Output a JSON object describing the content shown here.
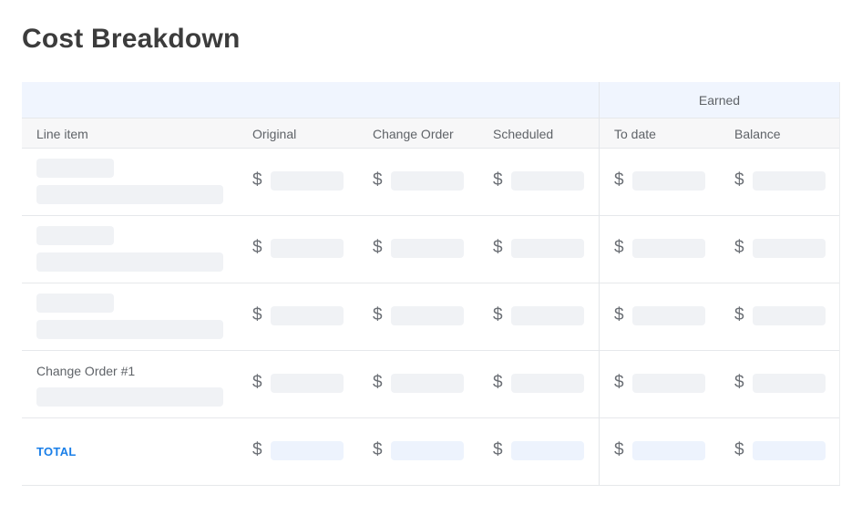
{
  "page": {
    "title": "Cost Breakdown"
  },
  "table": {
    "group_header": {
      "earned": "Earned"
    },
    "columns": [
      {
        "key": "line_item",
        "label": "Line item"
      },
      {
        "key": "original",
        "label": "Original"
      },
      {
        "key": "change_order",
        "label": "Change Order"
      },
      {
        "key": "scheduled",
        "label": "Scheduled"
      },
      {
        "key": "to_date",
        "label": "To date"
      },
      {
        "key": "balance",
        "label": "Balance"
      }
    ],
    "currency_symbol": "$",
    "rows": [
      {
        "type": "placeholder",
        "label": ""
      },
      {
        "type": "placeholder",
        "label": ""
      },
      {
        "type": "placeholder",
        "label": ""
      },
      {
        "type": "change_order",
        "label": "Change Order #1"
      },
      {
        "type": "total",
        "label": "TOTAL"
      }
    ]
  },
  "colors": {
    "title": "#3c3c3c",
    "group_header_bg": "#f0f5fe",
    "column_header_bg": "#f7f7f8",
    "skeleton": "#f0f2f5",
    "total_skeleton": "#edf3fd",
    "total_label": "#1a7fe8"
  }
}
